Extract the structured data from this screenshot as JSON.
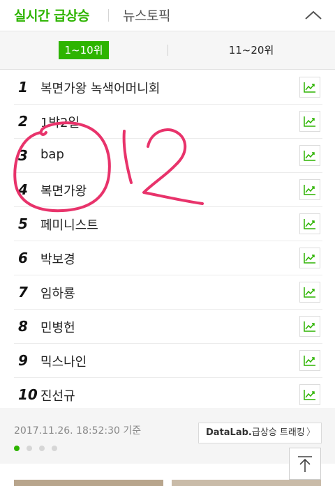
{
  "header": {
    "tab_active": "실시간 급상승",
    "tab_inactive": "뉴스토픽"
  },
  "range": {
    "active": "1~10위",
    "inactive": "11~20위"
  },
  "items": [
    {
      "rank": "1",
      "keyword": "복면가왕 녹색어머니회"
    },
    {
      "rank": "2",
      "keyword": "1박2일"
    },
    {
      "rank": "3",
      "keyword": "bap"
    },
    {
      "rank": "4",
      "keyword": "복면가왕"
    },
    {
      "rank": "5",
      "keyword": "페미니스트"
    },
    {
      "rank": "6",
      "keyword": "박보경"
    },
    {
      "rank": "7",
      "keyword": "임하룡"
    },
    {
      "rank": "8",
      "keyword": "민병헌"
    },
    {
      "rank": "9",
      "keyword": "믹스나인"
    },
    {
      "rank": "10",
      "keyword": "진선규"
    }
  ],
  "footer": {
    "timestamp": "2017.11.26. 18:52:30 기준",
    "datalab_brand": "DataLab.",
    "datalab_label": "급상승 트래킹",
    "datalab_chevron": "〉"
  },
  "colors": {
    "accent": "#2db400",
    "annotation": "#e8336b"
  },
  "icons": [
    "chevron-up-icon",
    "trend-chart-icon",
    "arrow-up-to-top-icon"
  ]
}
